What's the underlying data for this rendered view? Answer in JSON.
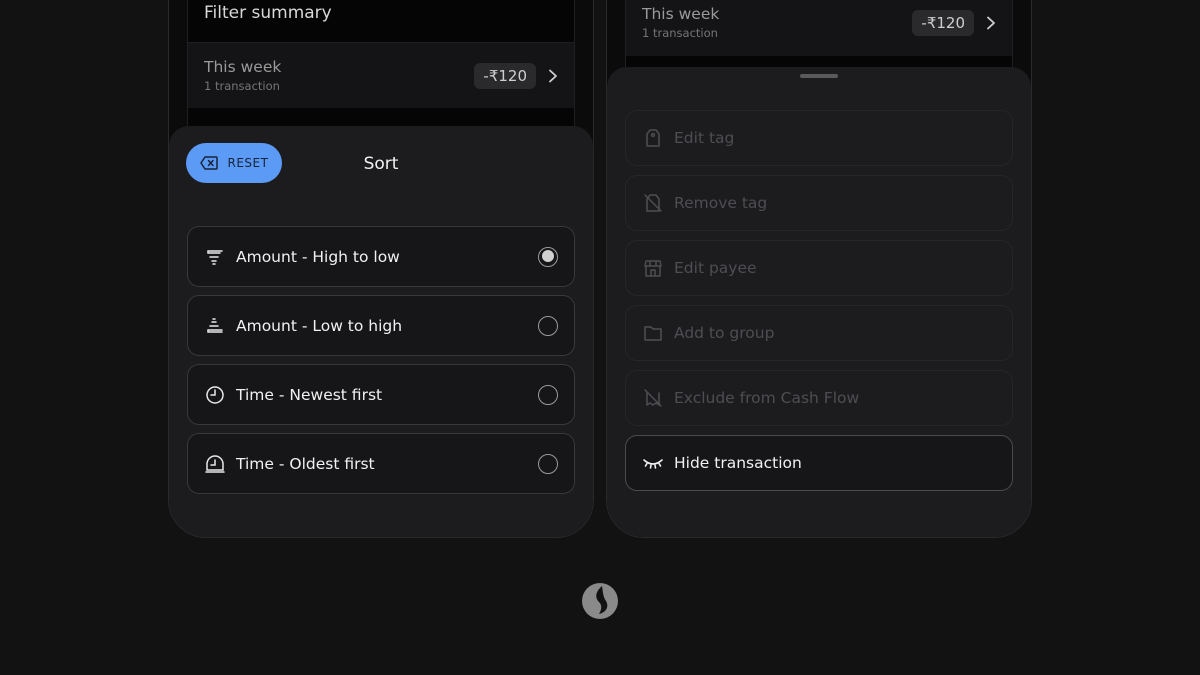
{
  "left_screen": {
    "summary_title": "Filter summary",
    "week_row": {
      "title": "This week",
      "subtitle": "1 transaction",
      "amount": "-₹120"
    },
    "sort_sheet": {
      "reset_label": "RESET",
      "title": "Sort",
      "options": [
        {
          "label": "Amount - High to low",
          "icon": "sort-descending-icon",
          "selected": true
        },
        {
          "label": "Amount - Low to high",
          "icon": "sort-ascending-icon",
          "selected": false
        },
        {
          "label": "Time - Newest first",
          "icon": "clock-icon",
          "selected": false
        },
        {
          "label": "Time - Oldest first",
          "icon": "clock-history-icon",
          "selected": false
        }
      ]
    }
  },
  "right_screen": {
    "week_row": {
      "title": "This week",
      "subtitle": "1 transaction",
      "amount": "-₹120"
    },
    "actions": [
      {
        "label": "Edit tag",
        "icon": "tag-icon",
        "enabled": false
      },
      {
        "label": "Remove tag",
        "icon": "tag-off-icon",
        "enabled": false
      },
      {
        "label": "Edit payee",
        "icon": "store-icon",
        "enabled": false
      },
      {
        "label": "Add to group",
        "icon": "folder-icon",
        "enabled": false
      },
      {
        "label": "Exclude from Cash Flow",
        "icon": "exclude-icon",
        "enabled": false
      },
      {
        "label": "Hide transaction",
        "icon": "eye-closed-icon",
        "enabled": true
      }
    ]
  },
  "colors": {
    "background": "#121212",
    "sheet": "#1c1c1f",
    "accent": "#5b9bf5"
  },
  "brand_logo_icon": "brand-logo-icon"
}
